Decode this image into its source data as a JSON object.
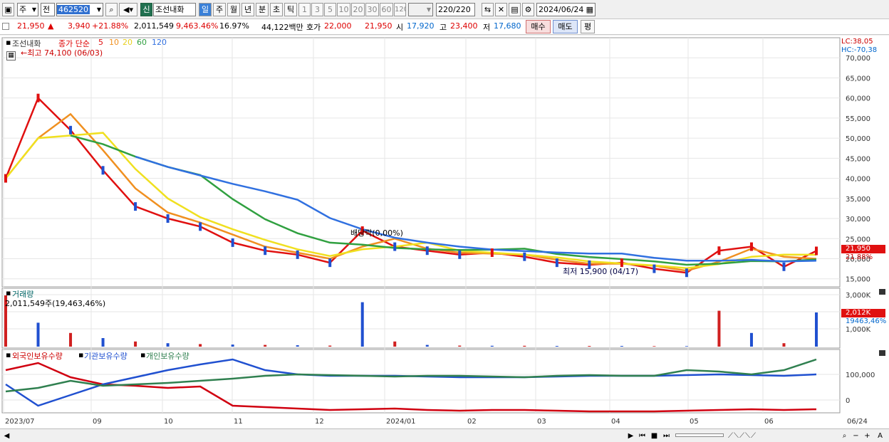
{
  "toolbar": {
    "market": "주",
    "period_type": "전",
    "code": "462520",
    "name_badge": "신",
    "stock_name": "조선내화",
    "periods": [
      "일",
      "주",
      "월",
      "년",
      "분",
      "초",
      "틱"
    ],
    "minutes": [
      "1",
      "3",
      "5",
      "10",
      "20",
      "30",
      "60",
      "120"
    ],
    "count": "220/220",
    "date": "2024/06/24"
  },
  "status": {
    "price": "21,950",
    "change_arrow": "▲",
    "change": "3,940",
    "change_pct": "+21.88%",
    "volume": "2,011,549",
    "volume_pct": "9,463.46%",
    "turnover": "16.97%",
    "amount": "44,122백만",
    "bid_label": "호가",
    "ask": "22,000",
    "bid": "21,950",
    "open_label": "시",
    "open": "17,920",
    "high_label": "고",
    "high": "23,400",
    "low_label": "저",
    "low": "17,680",
    "buy_label": "매수",
    "sell_label": "매도",
    "eval_label": "평"
  },
  "chart": {
    "legend_name": "조선내화",
    "legend_ma_label": "종가 단순",
    "ma_periods": [
      "5",
      "10",
      "20",
      "60",
      "120"
    ],
    "ma_colors": [
      "#e01010",
      "#f09020",
      "#f0e020",
      "#30a040",
      "#3070e0"
    ],
    "max_annotation": "←최고 74,100 (06/03)",
    "min_annotation": "최저 15,900 (04/17)",
    "dividend_annotation": "배당락(0,00%)",
    "lc": "LC:38,05",
    "hc": "HC:-70,38",
    "price_ticks": [
      "70,000",
      "65,000",
      "60,000",
      "55,000",
      "50,000",
      "45,000",
      "40,000",
      "35,000",
      "30,000",
      "25,000",
      "20,000",
      "15,000"
    ],
    "current_price_tag": "21,950",
    "current_pct_tag": "21.88%",
    "volume_title": "거래량",
    "volume_info": "2,011,549주(19,463,46%)",
    "volume_ticks": [
      "3,000K",
      "2,000K",
      "1,000K"
    ],
    "volume_tag": "2,012K",
    "volume_pct_tag": "19463,46%",
    "holdings_legend": [
      "외국인보유수량",
      "기관보유수량",
      "개인보유수량"
    ],
    "holdings_ticks": [
      "100,000",
      "0"
    ],
    "x_ticks": [
      "2023/07",
      "09",
      "10",
      "11",
      "12",
      "2024/01",
      "02",
      "03",
      "04",
      "05",
      "06",
      "06/24"
    ]
  },
  "chart_data": {
    "type": "line",
    "title": "조선내화",
    "ylim": [
      13000,
      75000
    ],
    "series": [
      {
        "name": "종가",
        "x": [
          "2023/07",
          "2023/07",
          "2023/07",
          "2023/08",
          "2023/08",
          "2023/09",
          "2023/09",
          "2023/10",
          "2023/10",
          "2023/11",
          "2023/11",
          "2023/11",
          "2023/12",
          "2023/12",
          "2024/01",
          "2024/01",
          "2024/02",
          "2024/02",
          "2024/03",
          "2024/03",
          "2024/04",
          "2024/04",
          "2024/05",
          "2024/05",
          "2024/06",
          "2024/06/24"
        ],
        "values": [
          40000,
          60000,
          52000,
          42000,
          33000,
          30000,
          28000,
          24000,
          22000,
          21000,
          19000,
          27000,
          23000,
          22000,
          21000,
          21500,
          20500,
          19000,
          18500,
          19000,
          17500,
          16500,
          22000,
          23000,
          18000,
          21950
        ]
      }
    ],
    "annotations": {
      "max": "74,100 (06/03)",
      "min": "15,900 (04/17)"
    }
  }
}
